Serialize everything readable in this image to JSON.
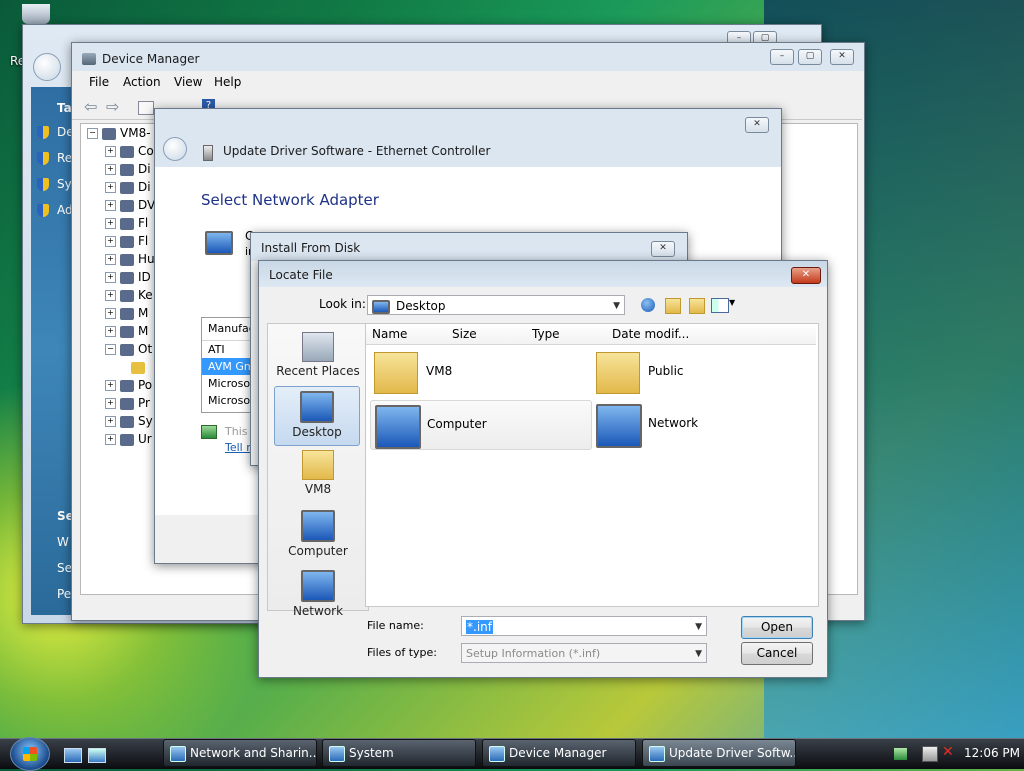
{
  "desktop": {
    "recycle_label": "Re"
  },
  "control_panel": {
    "task_header": "Ta",
    "tasks": [
      "De",
      "Re",
      "Sy",
      "Ad"
    ],
    "see_also": [
      "Se",
      "W",
      "Se",
      "Pe"
    ]
  },
  "device_manager": {
    "title": "Device Manager",
    "menu": [
      "File",
      "Action",
      "View",
      "Help"
    ],
    "root": "VM8-",
    "tree": [
      "Co",
      "Di",
      "Di",
      "DV",
      "Fl",
      "Fl",
      "Hu",
      "ID",
      "Ke",
      "M",
      "M",
      "Ot",
      "",
      "Po",
      "Pr",
      "Sy",
      "Ur"
    ]
  },
  "update_driver": {
    "title": "Update Driver Software - Ethernet Controller",
    "heading": "Select Network Adapter",
    "desc_short": "C",
    "desc2": "ir",
    "manufacturer_header": "Manufac",
    "manufacturers": [
      "ATI",
      "AVM Gm",
      "Microsof",
      "Microsof"
    ],
    "signed_text": "This",
    "tell_link": "Tell m"
  },
  "install_from_disk": {
    "title": "Install From Disk"
  },
  "locate_file": {
    "title": "Locate File",
    "look_in_label": "Look in:",
    "look_in_value": "Desktop",
    "columns": [
      "Name",
      "Size",
      "Type",
      "Date modif..."
    ],
    "places": [
      "Recent Places",
      "Desktop",
      "VM8",
      "Computer",
      "Network"
    ],
    "items": [
      "VM8",
      "Public",
      "Computer",
      "Network"
    ],
    "file_name_label": "File name:",
    "file_name_value": "*.inf",
    "files_of_type_label": "Files of type:",
    "files_of_type_value": "Setup Information (*.inf)",
    "open_label": "Open",
    "cancel_label": "Cancel"
  },
  "taskbar": {
    "buttons": [
      "Network and Sharin...",
      "System",
      "Device Manager",
      "Update Driver Softw..."
    ],
    "clock": "12:06 PM"
  }
}
